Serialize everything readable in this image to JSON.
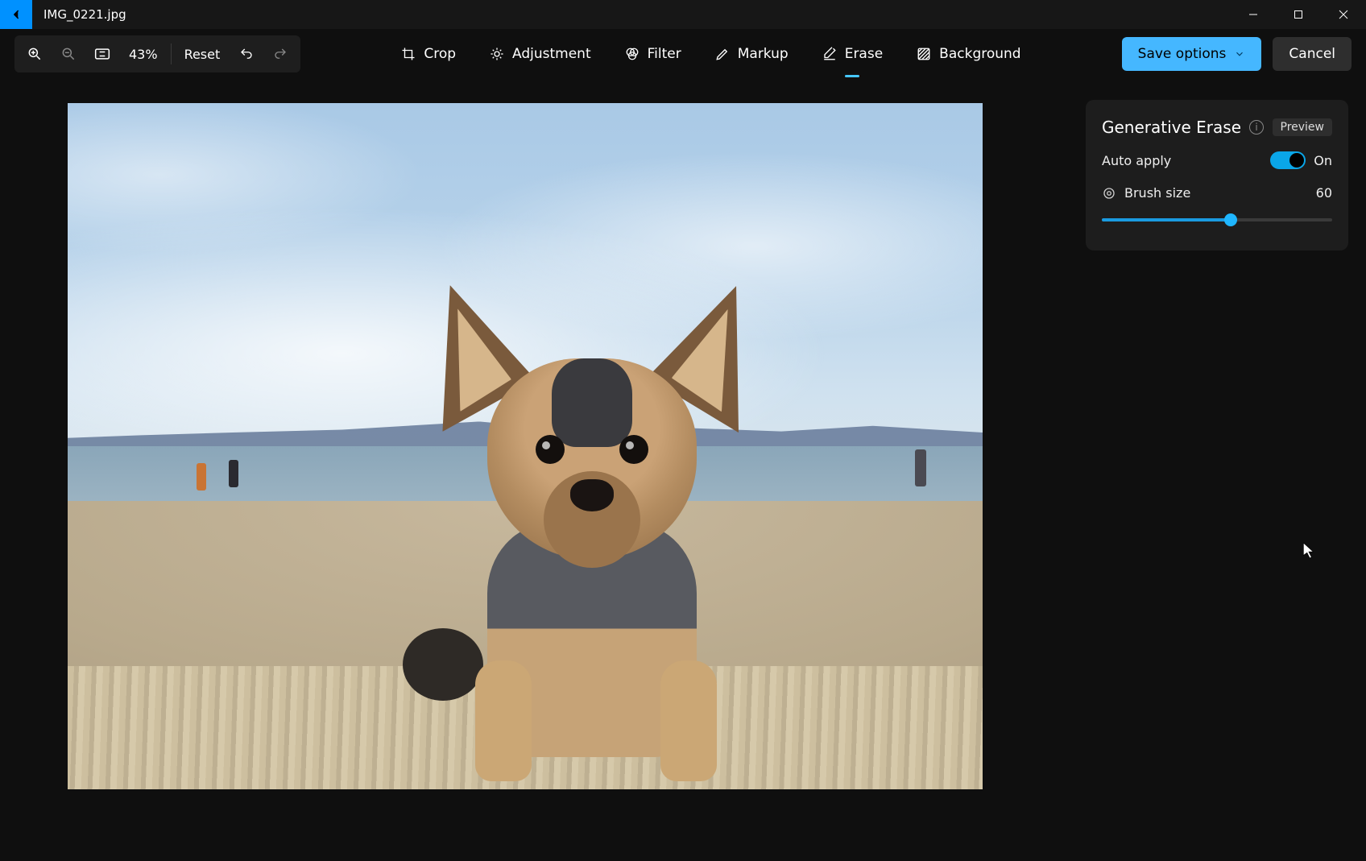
{
  "titlebar": {
    "filename": "IMG_0221.jpg"
  },
  "toolbar": {
    "zoom_percent": "43%",
    "reset_label": "Reset",
    "tabs": {
      "crop": "Crop",
      "adjustment": "Adjustment",
      "filter": "Filter",
      "markup": "Markup",
      "erase": "Erase",
      "background": "Background"
    },
    "save_label": "Save options",
    "cancel_label": "Cancel"
  },
  "panel": {
    "title": "Generative Erase",
    "badge": "Preview",
    "auto_apply_label": "Auto apply",
    "auto_apply_state": "On",
    "brush_label": "Brush size",
    "brush_value": "60",
    "brush_percent": 56
  }
}
